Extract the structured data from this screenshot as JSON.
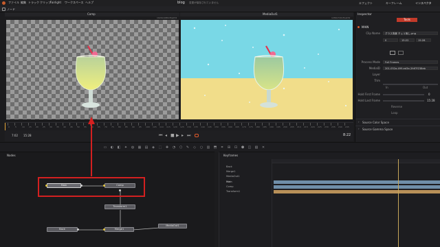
{
  "menu": {
    "items": [
      "ファイル",
      "編集",
      "トラック",
      "クリップ",
      "Fairlight",
      "ワークスペース",
      "ヘルプ"
    ],
    "project_title": "blog",
    "save_status": "変更が保存されていません",
    "right_items": [
      "エフェクト",
      "キーフレーム",
      "インスペクタ"
    ]
  },
  "toolbar": {
    "left_label": "ノード"
  },
  "viewers": {
    "left_title": "Comp",
    "right_title": "MediaOut1",
    "left_resolution": "1920x1080xfloat32",
    "right_resolution": "1280x720xfloat32"
  },
  "transport": {
    "timecode_in": "7:02",
    "timecode_out": "15:28",
    "current_time": "8:22",
    "ruler_ticks": [
      "0",
      "5",
      "10",
      "15",
      "20",
      "25",
      "30",
      "35",
      "40",
      "45",
      "50",
      "55",
      "60",
      "65",
      "70",
      "75",
      "80",
      "85",
      "90",
      "95",
      "100",
      "105",
      "110",
      "115",
      "120",
      "125",
      "130",
      "135",
      "140",
      "145",
      "150",
      "155",
      "160",
      "165",
      "170",
      "175",
      "180",
      "185",
      "190",
      "195",
      "200",
      "205",
      "210",
      "215",
      "220",
      "225",
      "230",
      "235",
      "240",
      "245"
    ]
  },
  "inspector": {
    "title": "Inspector",
    "node_name": "MAIN",
    "tab_tools": "Tools",
    "fields": [
      {
        "label": "Clip Name",
        "value": "グラス背景 チェリ無し.png"
      },
      {
        "label": "Process Mode",
        "value": "Full Frames"
      },
      {
        "label": "MediaID",
        "value": "201-052a-499-ed3e-2fdf7f238eb"
      },
      {
        "label": "Layer",
        "value": ""
      },
      {
        "label": "Trim",
        "value": ""
      },
      {
        "label": "Hold First Frame",
        "value": "0"
      },
      {
        "label": "Hold Last Frame",
        "value": "15:28"
      }
    ],
    "trim_values": [
      "In",
      "Out"
    ],
    "checkbox_labels": [
      "Reverse",
      "Loop"
    ],
    "sections": [
      "Source Color Space",
      "Source Gamma Space"
    ],
    "range_values": [
      "0",
      "15:22",
      "15:28"
    ]
  },
  "nodes_panel": {
    "title": "Nodes",
    "nodes": [
      {
        "name": "Main"
      },
      {
        "name": "Comp"
      },
      {
        "name": "Transform1"
      },
      {
        "name": "Back"
      },
      {
        "name": "Merge1"
      },
      {
        "name": "MediaOut1"
      }
    ]
  },
  "keyframes_panel": {
    "title": "Keyframes",
    "items": [
      "Back",
      "Merge1",
      "MediaOut1",
      "Main",
      "Comp",
      "Transform1"
    ]
  },
  "colors": {
    "highlight": "#d42020",
    "accent_orange": "#e05a2a",
    "sky": "#79d8e6",
    "sand": "#f1dd8a",
    "kf_blue": "#6f8ea8",
    "kf_orange": "#b89058"
  }
}
